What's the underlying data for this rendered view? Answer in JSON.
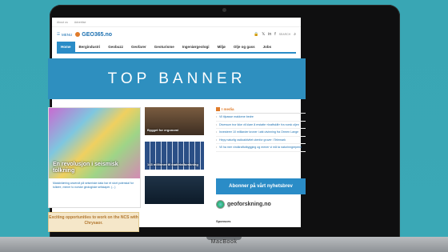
{
  "device": {
    "brand": "MacBook"
  },
  "site": {
    "topbar": [
      "About us",
      "Advertise"
    ],
    "menu_label": "MENU",
    "logo": "GEO365.no",
    "search_label": "SEARCH"
  },
  "nav": [
    "Home",
    "Bergindustri",
    "Geobuzz",
    "Geofarer",
    "Geoturisme",
    "Ingeniørgeologi",
    "Miljø",
    "Olje og gass",
    "Jobs"
  ],
  "banner": "TOP BANNER",
  "main_article": {
    "title": "En revolusjon i seismisk tolkning",
    "excerpt": "Maskinlæring anvendt på seismiske data har et stort potensial for tolkere, mener to norske geologiske selskaper. (...)"
  },
  "side_articles": [
    {
      "caption": "Bygget for ergonomi"
    },
    {
      "caption": "143 millioner til materialforskning"
    },
    {
      "caption": ""
    }
  ],
  "in_media": {
    "heading": "I media",
    "items": [
      "Vil tilpasse makkene bedre",
      "Diversum tror ikke vil klare å erstatte «kraftskilt» fra norsk oljen",
      "Investerer 10 milliarder kroner i økt utvinning fra Ormen Lange",
      "Hepy naturlig radioaktivitet utenfor gruver i Telemark",
      "Vil ha mer vindkraftutbygging og mener vi må ta naturinngrepene"
    ]
  },
  "subscribe": "Abonner på vårt nyhetsbrev",
  "partner": "geoforskning.no",
  "sponsors": "Sponsors",
  "ad_text": "Exciting opportunities to work on the NCS with Chrysaor."
}
